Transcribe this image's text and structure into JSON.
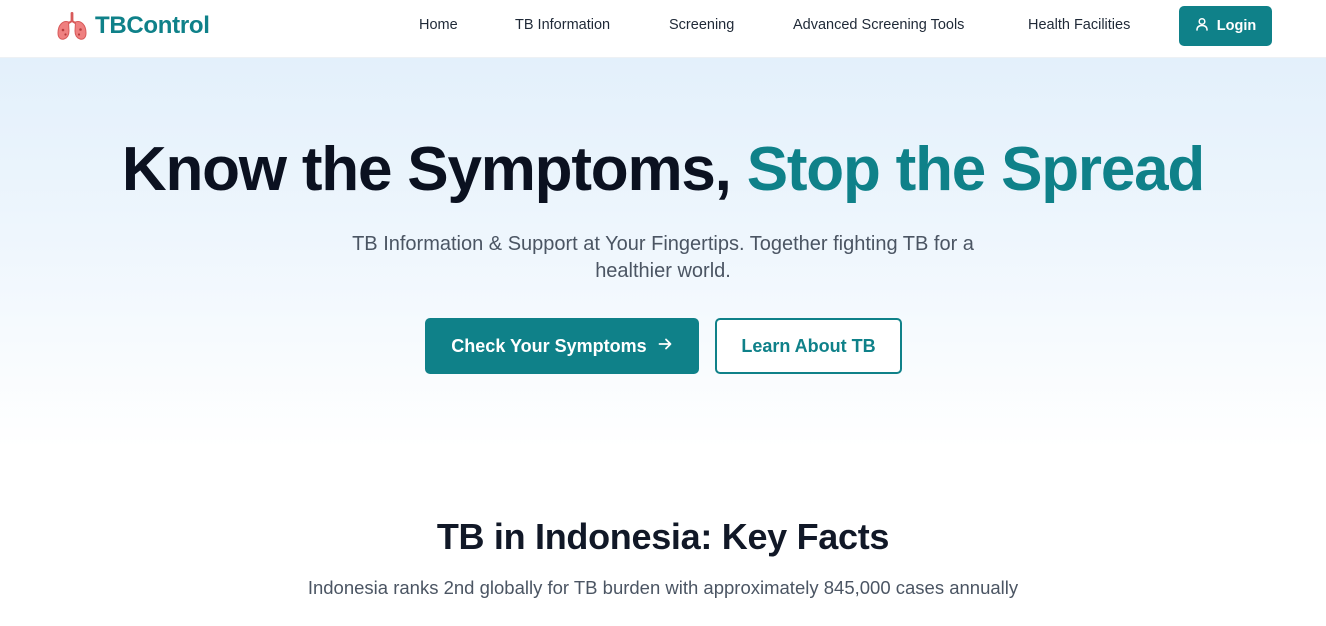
{
  "brand": {
    "name": "TBControl",
    "logo_icon": "lungs-icon"
  },
  "nav": {
    "items": [
      {
        "label": "Home"
      },
      {
        "label": "TB Information"
      },
      {
        "label": "Screening"
      },
      {
        "label": "Advanced Screening Tools"
      },
      {
        "label": "Health Facilities"
      }
    ],
    "login": {
      "label": "Login",
      "icon": "user-icon"
    }
  },
  "hero": {
    "title_part1": "Know the Symptoms, ",
    "title_accent": "Stop the Spread",
    "subtitle": "TB Information & Support at Your Fingertips. Together fighting TB for a healthier world.",
    "primary_button": {
      "label": "Check Your Symptoms",
      "icon": "arrow-right-icon"
    },
    "secondary_button": {
      "label": "Learn About TB"
    }
  },
  "facts": {
    "title": "TB in Indonesia: Key Facts",
    "subtitle": "Indonesia ranks 2nd globally for TB burden with approximately 845,000 cases annually"
  },
  "colors": {
    "accent": "#0f8189",
    "heading": "#0b1120",
    "body_text": "#4b5563",
    "logo": "#e86a6a"
  }
}
